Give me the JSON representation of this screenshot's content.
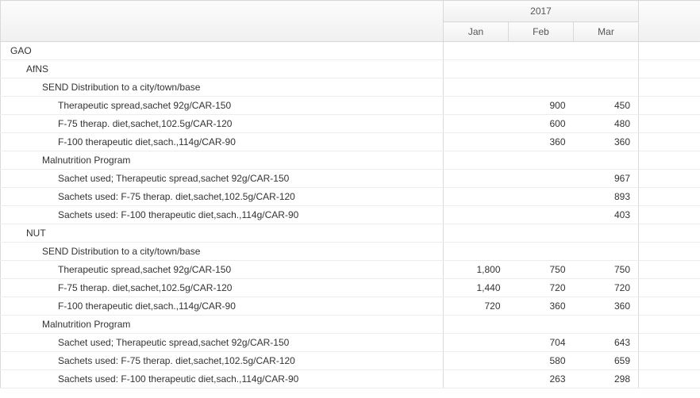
{
  "header": {
    "year": "2017",
    "months": [
      "Jan",
      "Feb",
      "Mar"
    ]
  },
  "rows": [
    {
      "indent": 0,
      "label": "GAO",
      "values": [
        "",
        "",
        ""
      ]
    },
    {
      "indent": 1,
      "label": "AfNS",
      "values": [
        "",
        "",
        ""
      ]
    },
    {
      "indent": 2,
      "label": "SEND Distribution to a city/town/base",
      "values": [
        "",
        "",
        ""
      ]
    },
    {
      "indent": 3,
      "label": "Therapeutic spread,sachet 92g/CAR-150",
      "values": [
        "",
        "900",
        "450"
      ]
    },
    {
      "indent": 3,
      "label": "F-75 therap. diet,sachet,102.5g/CAR-120",
      "values": [
        "",
        "600",
        "480"
      ]
    },
    {
      "indent": 3,
      "label": "F-100 therapeutic diet,sach.,114g/CAR-90",
      "values": [
        "",
        "360",
        "360"
      ]
    },
    {
      "indent": 2,
      "label": "Malnutrition Program",
      "values": [
        "",
        "",
        ""
      ]
    },
    {
      "indent": 3,
      "label": "Sachet used; Therapeutic spread,sachet 92g/CAR-150",
      "values": [
        "",
        "",
        "967"
      ]
    },
    {
      "indent": 3,
      "label": "Sachets used: F-75 therap. diet,sachet,102.5g/CAR-120",
      "values": [
        "",
        "",
        "893"
      ]
    },
    {
      "indent": 3,
      "label": "Sachets used: F-100 therapeutic diet,sach.,114g/CAR-90",
      "values": [
        "",
        "",
        "403"
      ]
    },
    {
      "indent": 1,
      "label": "NUT",
      "values": [
        "",
        "",
        ""
      ]
    },
    {
      "indent": 2,
      "label": "SEND Distribution to a city/town/base",
      "values": [
        "",
        "",
        ""
      ]
    },
    {
      "indent": 3,
      "label": "Therapeutic spread,sachet 92g/CAR-150",
      "values": [
        "1,800",
        "750",
        "750"
      ]
    },
    {
      "indent": 3,
      "label": "F-75 therap. diet,sachet,102.5g/CAR-120",
      "values": [
        "1,440",
        "720",
        "720"
      ]
    },
    {
      "indent": 3,
      "label": "F-100 therapeutic diet,sach.,114g/CAR-90",
      "values": [
        "720",
        "360",
        "360"
      ]
    },
    {
      "indent": 2,
      "label": "Malnutrition Program",
      "values": [
        "",
        "",
        ""
      ]
    },
    {
      "indent": 3,
      "label": "Sachet used; Therapeutic spread,sachet 92g/CAR-150",
      "values": [
        "",
        "704",
        "643"
      ]
    },
    {
      "indent": 3,
      "label": "Sachets used: F-75 therap. diet,sachet,102.5g/CAR-120",
      "values": [
        "",
        "580",
        "659"
      ]
    },
    {
      "indent": 3,
      "label": "Sachets used: F-100 therapeutic diet,sach.,114g/CAR-90",
      "values": [
        "",
        "263",
        "298"
      ]
    }
  ]
}
